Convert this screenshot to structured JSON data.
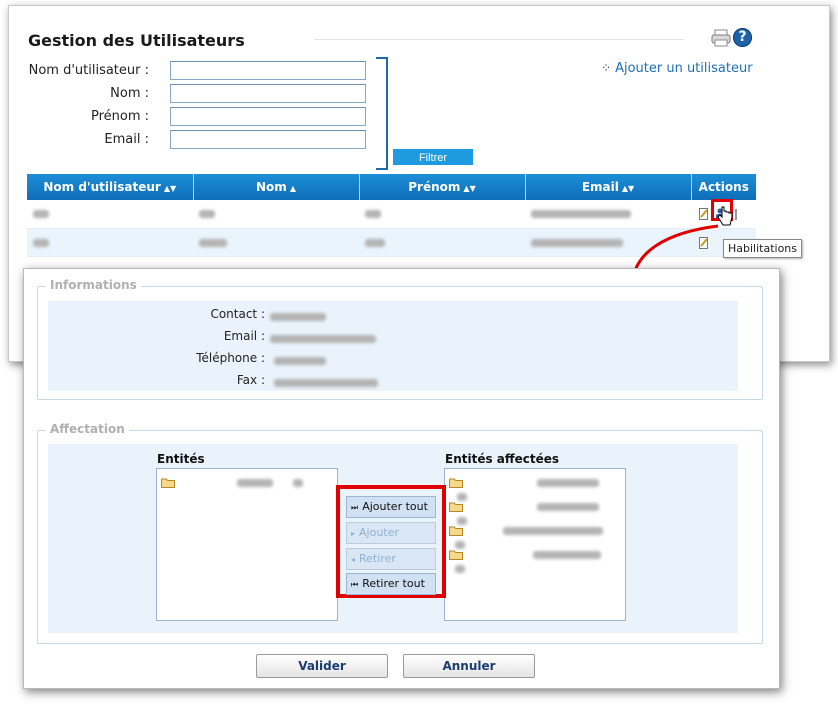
{
  "header": {
    "title": "Gestion des Utilisateurs",
    "help_glyph": "?",
    "add_user_label": "Ajouter un utilisateur"
  },
  "filter": {
    "username_label": "Nom d'utilisateur :",
    "lastname_label": "Nom :",
    "firstname_label": "Prénom :",
    "email_label": "Email :",
    "button_label": "Filtrer"
  },
  "table": {
    "columns": [
      "Nom d'utilisateur",
      "Nom",
      "Prénom",
      "Email",
      "Actions"
    ],
    "sort_glyphs": [
      "▲▼",
      "▲",
      "▲▼",
      "▲▼",
      ""
    ]
  },
  "tooltip": "Habilitations",
  "colors": {
    "accent": "#1e9be0",
    "header_blue": "#1c8fd8",
    "highlight": "#e00000",
    "panel": "#eaf3fb"
  },
  "informations": {
    "legend": "Informations",
    "contact_label": "Contact :",
    "email_label": "Email :",
    "phone_label": "Téléphone :",
    "fax_label": "Fax :"
  },
  "affectation": {
    "legend": "Affectation",
    "entities_title": "Entités",
    "assigned_title": "Entités affectées",
    "buttons": {
      "add_all": "Ajouter tout",
      "add": "Ajouter",
      "remove": "Retirer",
      "remove_all": "Retirer tout"
    }
  },
  "footer": {
    "validate_label": "Valider",
    "cancel_label": "Annuler"
  },
  "icons": [
    "print-icon",
    "help-icon",
    "folder-icon",
    "edit-icon",
    "habilitations-icon",
    "cursor-hand-icon",
    "red-arrow"
  ]
}
